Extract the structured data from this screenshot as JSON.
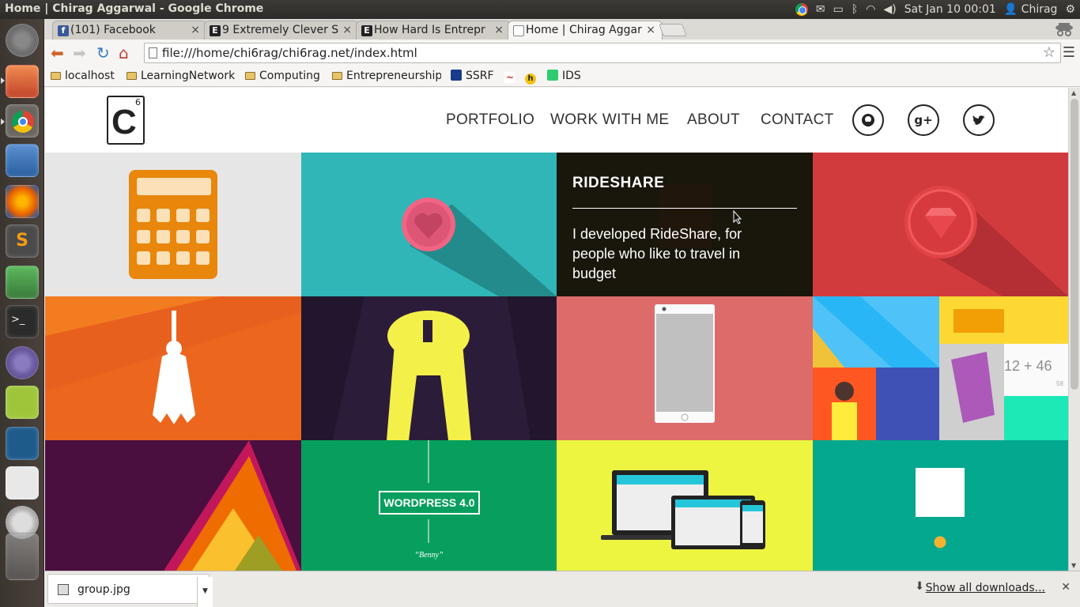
{
  "window": {
    "title": "Home | Chirag Aggarwal - Google Chrome"
  },
  "system_tray": {
    "datetime": "Sat Jan 10 00:01",
    "user": "Chirag"
  },
  "tabs": [
    {
      "title": "(101) Facebook",
      "icon": "facebook-icon",
      "active": false
    },
    {
      "title": "9 Extremely Clever S",
      "icon": "entrepreneur-icon",
      "active": false
    },
    {
      "title": "How Hard Is Entrepr",
      "icon": "entrepreneur-icon",
      "active": false
    },
    {
      "title": "Home | Chirag Aggar",
      "icon": "page-icon",
      "active": true
    }
  ],
  "toolbar": {
    "url": "file:///home/chi6rag/chi6rag.net/index.html"
  },
  "bookmarks": [
    {
      "label": "localhost",
      "type": "folder"
    },
    {
      "label": "LearningNetwork",
      "type": "folder"
    },
    {
      "label": "Computing",
      "type": "folder"
    },
    {
      "label": "Entrepreneurship",
      "type": "folder"
    },
    {
      "label": "SSRF",
      "type": "link"
    },
    {
      "label": "",
      "type": "link"
    },
    {
      "label": "",
      "type": "link"
    },
    {
      "label": "IDS",
      "type": "link"
    }
  ],
  "site": {
    "logo": {
      "letter": "C",
      "number": "6"
    },
    "nav": [
      "PORTFOLIO",
      "WORK WITH ME",
      "ABOUT",
      "CONTACT"
    ],
    "social": [
      "github-icon",
      "google-plus-icon",
      "twitter-icon"
    ],
    "social_labels": [
      "",
      "g+",
      ""
    ],
    "portfolio_overlay": {
      "title": "RIDESHARE",
      "text": "I developed RideShare, for people who like to travel in budget"
    },
    "tiles": {
      "wordpress_label": "WORDPRESS 4.0",
      "wordpress_sub": "“Benny”",
      "calc_text": "12 + 46",
      "calc_small": "58"
    }
  },
  "downloads": {
    "file": "group.jpg",
    "show_all": "Show all downloads..."
  },
  "colors": {
    "calculator_bg": "#e6e6e6",
    "heart_bg": "#31b6b7",
    "rideshare_overlay": "#161408",
    "ruby_bg": "#d23b3e",
    "broom_bg": "#f37c20",
    "dark_bg": "#2b1d3a",
    "phone_bg": "#dd6b6a",
    "material_bg": "#3f51b5",
    "triangle_bg": "#4a0f3e",
    "wordpress_bg": "#089f5e",
    "devices_bg": "#eef540",
    "teal_bg": "#03a88e"
  }
}
